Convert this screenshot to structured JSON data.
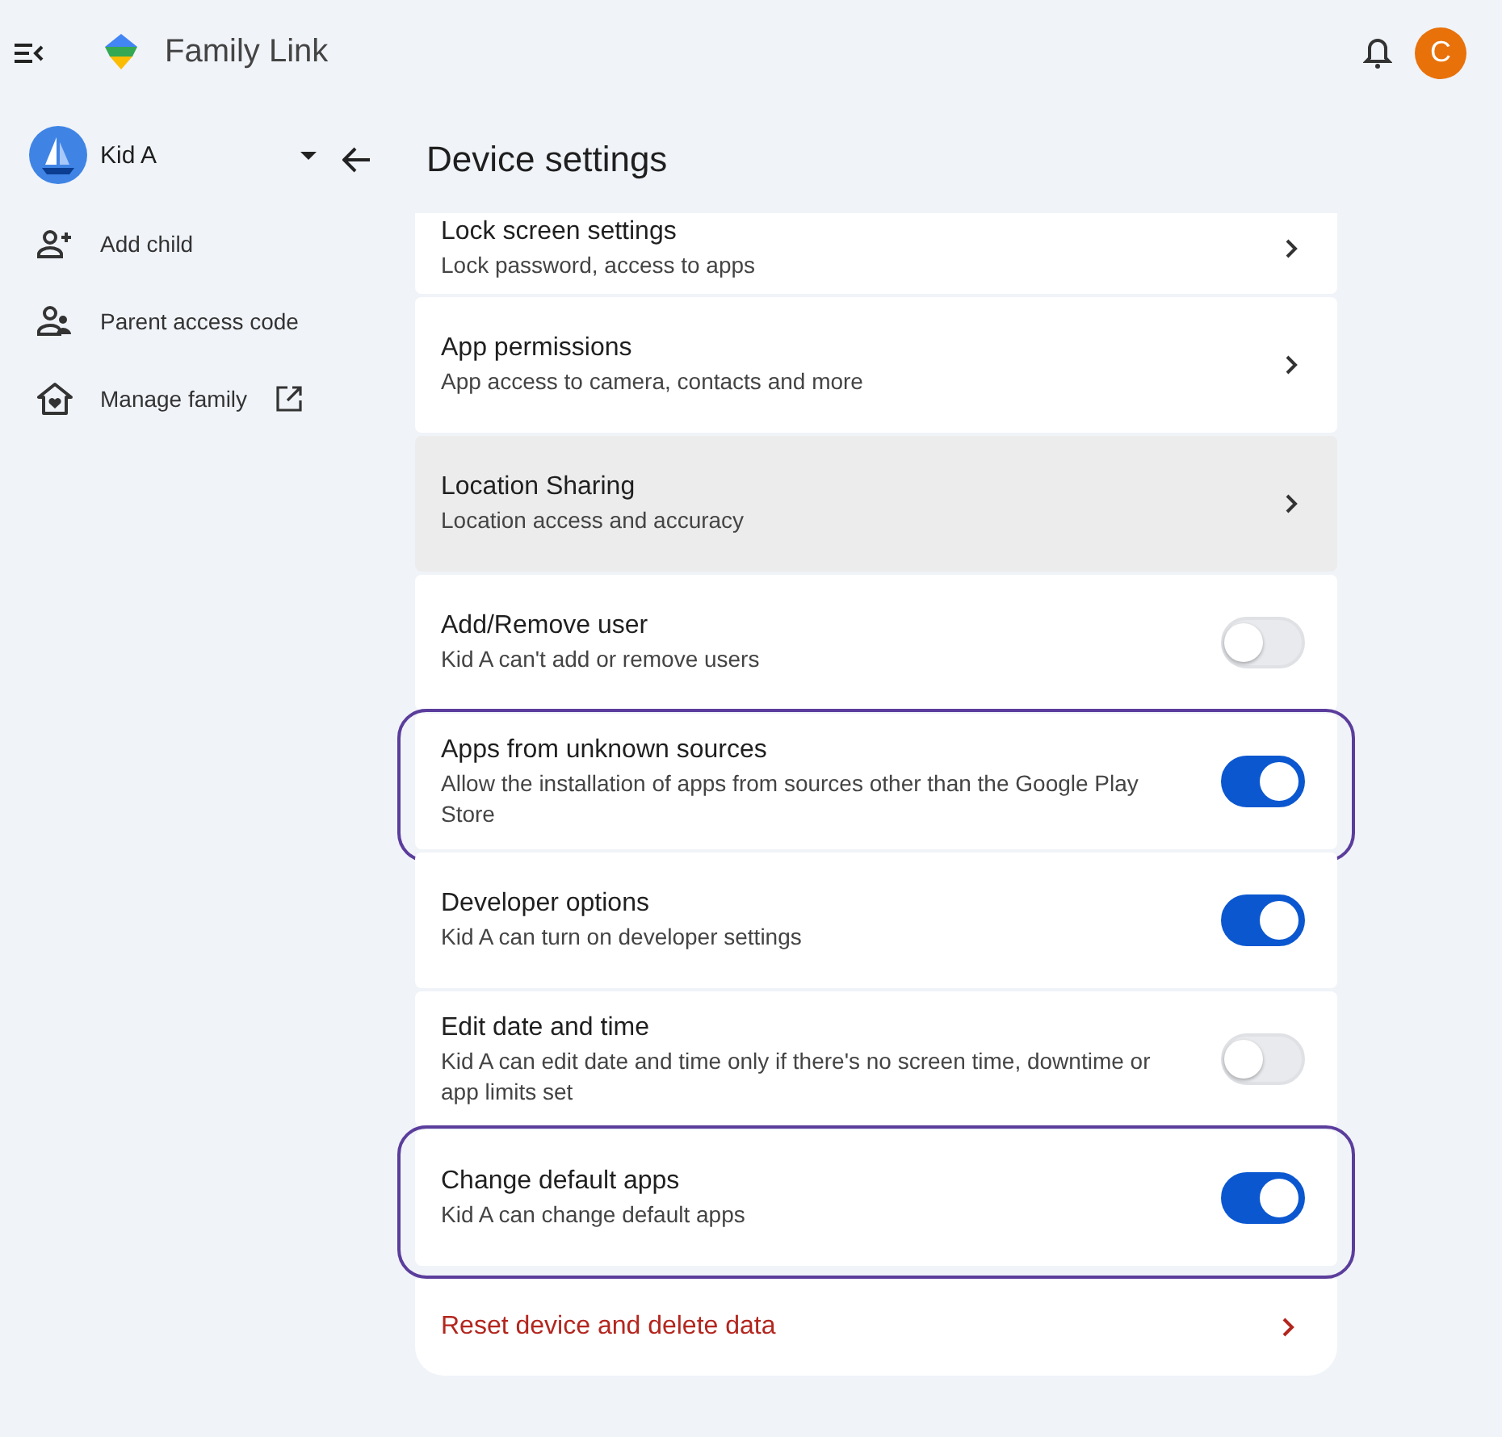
{
  "app": {
    "title": "Family Link",
    "account_initial": "C"
  },
  "sidebar": {
    "child": {
      "name": "Kid A"
    },
    "items": [
      {
        "label": "Add child",
        "kind": "add-person",
        "external": false
      },
      {
        "label": "Parent access code",
        "kind": "people",
        "external": false
      },
      {
        "label": "Manage family",
        "kind": "home",
        "external": true
      }
    ]
  },
  "page": {
    "title": "Device settings"
  },
  "rows": [
    {
      "kind": "link",
      "title": "Lock screen settings",
      "subtitle": "Lock password, access to apps",
      "hovered": false,
      "highlighted": false
    },
    {
      "kind": "link",
      "title": "App permissions",
      "subtitle": "App access to camera, contacts and more",
      "hovered": false,
      "highlighted": false
    },
    {
      "kind": "link",
      "title": "Location Sharing",
      "subtitle": "Location access and accuracy",
      "hovered": true,
      "highlighted": false
    },
    {
      "kind": "toggle",
      "title": "Add/Remove user",
      "subtitle": "Kid A can't add or remove users",
      "on": false,
      "hovered": false,
      "highlighted": false
    },
    {
      "kind": "toggle",
      "title": "Apps from unknown sources",
      "subtitle": "Allow the installation of apps from sources other than the Google Play Store",
      "on": true,
      "hovered": false,
      "highlighted": true
    },
    {
      "kind": "toggle",
      "title": "Developer options",
      "subtitle": "Kid A can turn on developer settings",
      "on": true,
      "hovered": false,
      "highlighted": false
    },
    {
      "kind": "toggle",
      "title": "Edit date and time",
      "subtitle": "Kid A can edit date and time only if there's no screen time, downtime or app limits set",
      "on": false,
      "hovered": false,
      "highlighted": false
    },
    {
      "kind": "toggle",
      "title": "Change default apps",
      "subtitle": "Kid A can change default apps",
      "on": true,
      "hovered": false,
      "highlighted": true
    },
    {
      "kind": "danger",
      "title": "Reset device and delete data",
      "hovered": false,
      "highlighted": false
    }
  ]
}
